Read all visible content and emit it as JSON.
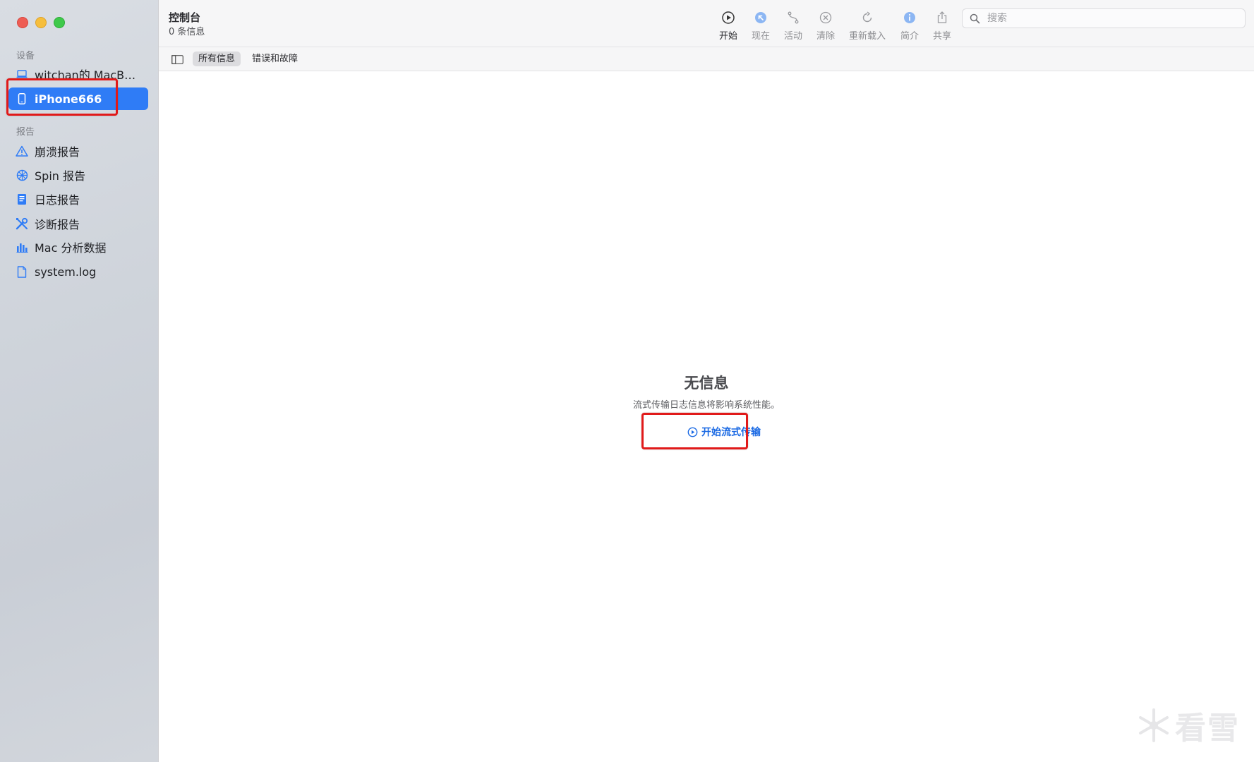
{
  "sidebar": {
    "section_devices": "设备",
    "section_reports": "报告",
    "devices": [
      {
        "label": "witchan的 MacBo...",
        "icon": "laptop-icon"
      },
      {
        "label": "iPhone666",
        "icon": "iphone-icon",
        "selected": true
      }
    ],
    "reports": [
      {
        "label": "崩溃报告",
        "icon": "warning-triangle-icon"
      },
      {
        "label": "Spin 报告",
        "icon": "spin-wheel-icon"
      },
      {
        "label": "日志报告",
        "icon": "document-list-icon"
      },
      {
        "label": "诊断报告",
        "icon": "tools-icon"
      },
      {
        "label": "Mac 分析数据",
        "icon": "bar-chart-icon"
      },
      {
        "label": "system.log",
        "icon": "file-icon"
      }
    ]
  },
  "toolbar": {
    "title": "控制台",
    "subtitle": "0 条信息",
    "buttons": [
      {
        "label": "开始",
        "icon": "play-icon"
      },
      {
        "label": "现在",
        "icon": "now-arrow-icon"
      },
      {
        "label": "活动",
        "icon": "activity-icon"
      },
      {
        "label": "清除",
        "icon": "clear-icon"
      },
      {
        "label": "重新载入",
        "icon": "reload-icon"
      },
      {
        "label": "简介",
        "icon": "info-icon"
      },
      {
        "label": "共享",
        "icon": "share-icon"
      }
    ],
    "search_placeholder": "搜索"
  },
  "filterbar": {
    "all_messages": "所有信息",
    "errors_faults": "错误和故障"
  },
  "main": {
    "empty_title": "无信息",
    "empty_desc": "流式传输日志信息将影响系统性能。",
    "start_streaming": "开始流式传输"
  },
  "colors": {
    "accent": "#2f7cf6",
    "link": "#1b6ae4",
    "highlight": "#e11a1a"
  }
}
